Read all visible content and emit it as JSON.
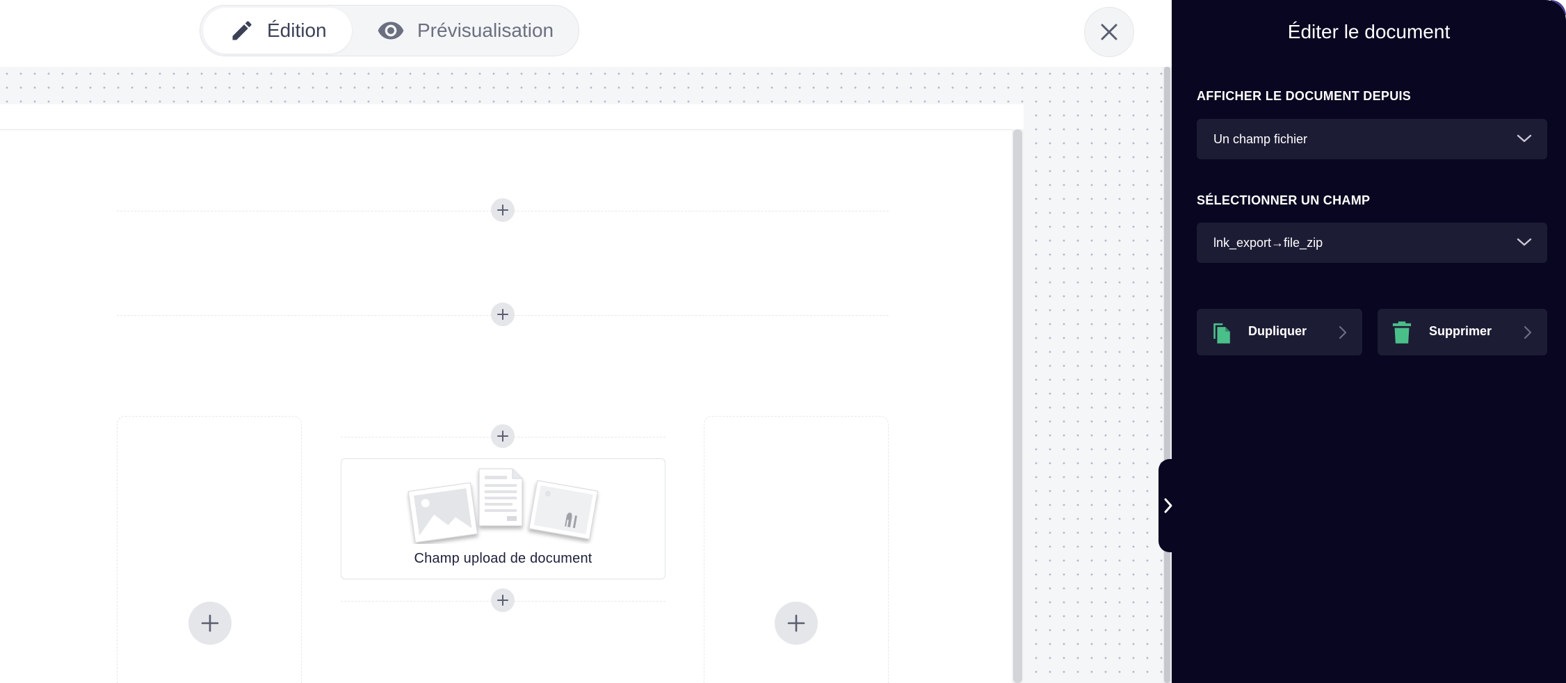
{
  "toolbar": {
    "edit_label": "Édition",
    "preview_label": "Prévisualisation"
  },
  "canvas": {
    "upload_block_label": "Champ upload de document"
  },
  "panel": {
    "title": "Éditer le document",
    "source_label": "AFFICHER LE DOCUMENT DEPUIS",
    "source_value": "Un champ fichier",
    "field_label": "SÉLECTIONNER UN CHAMP",
    "field_value": "lnk_export→file_zip",
    "duplicate_label": "Dupliquer",
    "delete_label": "Supprimer"
  },
  "colors": {
    "panel_bg": "#080620",
    "panel_control_bg": "#1d1c35",
    "accent_green": "#4bbf8a"
  },
  "icons": [
    "pencil-icon",
    "eye-icon",
    "close-icon",
    "plus-icon",
    "chevron-down-icon",
    "duplicate-icon",
    "trash-icon",
    "chevron-right-icon"
  ]
}
